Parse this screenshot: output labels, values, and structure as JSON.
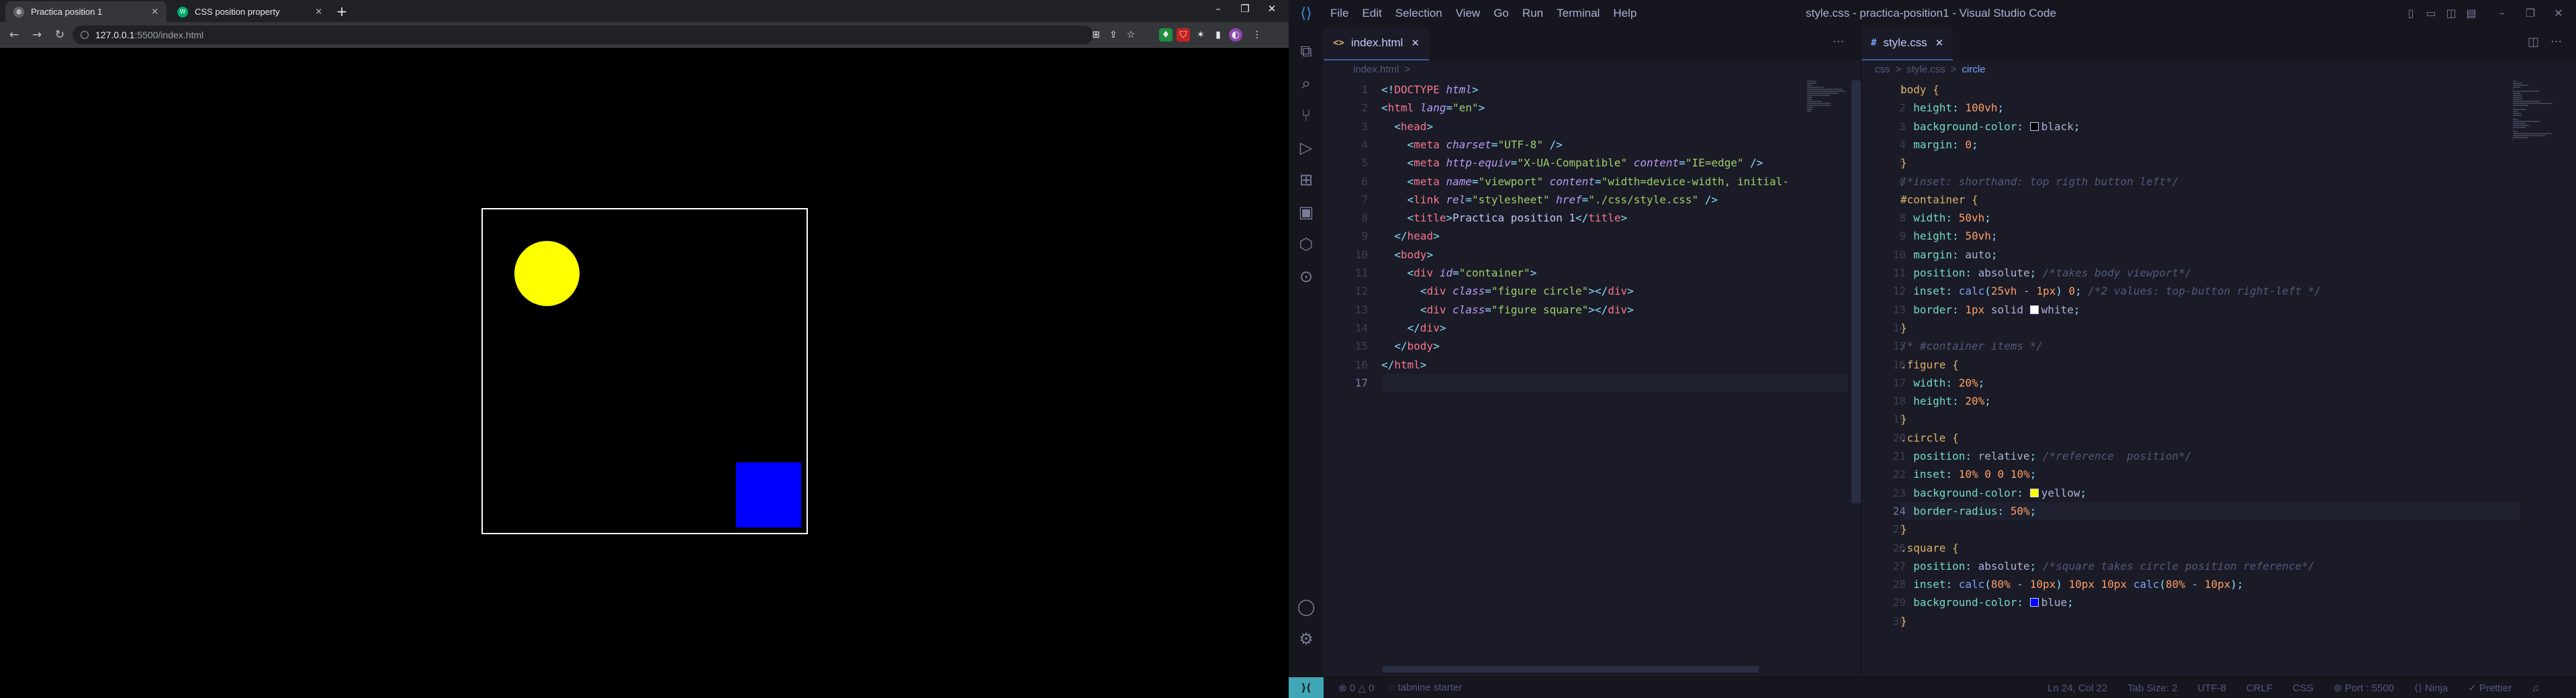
{
  "browser": {
    "tabs": [
      {
        "title": "Practica position 1",
        "favicon": "globe-icon",
        "active": true
      },
      {
        "title": "CSS position property",
        "favicon": "w3schools-icon",
        "active": false
      }
    ],
    "tab_close": "×",
    "new_tab": "+",
    "window_controls": {
      "minimize": "–",
      "maximize": "❐",
      "close": "✕"
    },
    "url": {
      "host": "127.0.0.1",
      "path": ":5500/index.html"
    },
    "nav": {
      "back": "←",
      "forward": "→",
      "reload": "↻"
    },
    "extensions": [
      "⊞",
      "⇪",
      "☆",
      "♦",
      "⛉",
      "✶",
      "▮",
      "◐",
      "⋮"
    ],
    "page": {
      "container_border": "#ffffff",
      "circle_color": "#ffff00",
      "square_color": "#0000ff",
      "background": "#000000"
    }
  },
  "vscode": {
    "menu": [
      "File",
      "Edit",
      "Selection",
      "View",
      "Go",
      "Run",
      "Terminal",
      "Help"
    ],
    "window_title": "style.css - practica-position1 - Visual Studio Code",
    "title_controls": [
      "▯",
      "▭",
      "◫",
      "▤",
      "–",
      "❐",
      "✕"
    ],
    "activity": [
      "⧉",
      "⌕",
      "⑂",
      "▷",
      "⊞",
      "▣",
      "⬡",
      "⊙"
    ],
    "activity_bottom": [
      "◯",
      "⚙"
    ],
    "left_editor": {
      "tab": {
        "icon": "<>",
        "name": "index.html",
        "close": "✕"
      },
      "more": "···",
      "breadcrumb": [
        "index.html",
        ">"
      ],
      "current_line": 17,
      "lines": [
        [
          [
            "pu",
            "<!"
          ],
          [
            "tg",
            "DOCTYPE"
          ],
          [
            "tx",
            " "
          ],
          [
            "at",
            "html"
          ],
          [
            "pu",
            ">"
          ]
        ],
        [
          [
            "pu",
            "<"
          ],
          [
            "tg",
            "html"
          ],
          [
            "tx",
            " "
          ],
          [
            "at",
            "lang"
          ],
          [
            "pu",
            "="
          ],
          [
            "st",
            "\"en\""
          ],
          [
            "pu",
            ">"
          ]
        ],
        [
          [
            "tx",
            "  "
          ],
          [
            "pu",
            "<"
          ],
          [
            "tg",
            "head"
          ],
          [
            "pu",
            ">"
          ]
        ],
        [
          [
            "tx",
            "    "
          ],
          [
            "pu",
            "<"
          ],
          [
            "tg",
            "meta"
          ],
          [
            "tx",
            " "
          ],
          [
            "at",
            "charset"
          ],
          [
            "pu",
            "="
          ],
          [
            "st",
            "\"UTF-8\""
          ],
          [
            "tx",
            " "
          ],
          [
            "pu",
            "/>"
          ]
        ],
        [
          [
            "tx",
            "    "
          ],
          [
            "pu",
            "<"
          ],
          [
            "tg",
            "meta"
          ],
          [
            "tx",
            " "
          ],
          [
            "at",
            "http-equiv"
          ],
          [
            "pu",
            "="
          ],
          [
            "st",
            "\"X-UA-Compatible\""
          ],
          [
            "tx",
            " "
          ],
          [
            "at",
            "content"
          ],
          [
            "pu",
            "="
          ],
          [
            "st",
            "\"IE=edge\""
          ],
          [
            "tx",
            " "
          ],
          [
            "pu",
            "/>"
          ]
        ],
        [
          [
            "tx",
            "    "
          ],
          [
            "pu",
            "<"
          ],
          [
            "tg",
            "meta"
          ],
          [
            "tx",
            " "
          ],
          [
            "at",
            "name"
          ],
          [
            "pu",
            "="
          ],
          [
            "st",
            "\"viewport\""
          ],
          [
            "tx",
            " "
          ],
          [
            "at",
            "content"
          ],
          [
            "pu",
            "="
          ],
          [
            "st",
            "\"width=device-width, initial-"
          ]
        ],
        [
          [
            "tx",
            "    "
          ],
          [
            "pu",
            "<"
          ],
          [
            "tg",
            "link"
          ],
          [
            "tx",
            " "
          ],
          [
            "at",
            "rel"
          ],
          [
            "pu",
            "="
          ],
          [
            "st",
            "\"stylesheet\""
          ],
          [
            "tx",
            " "
          ],
          [
            "at",
            "href"
          ],
          [
            "pu",
            "="
          ],
          [
            "st",
            "\"./css/style.css\""
          ],
          [
            "tx",
            " "
          ],
          [
            "pu",
            "/>"
          ]
        ],
        [
          [
            "tx",
            "    "
          ],
          [
            "pu",
            "<"
          ],
          [
            "tg",
            "title"
          ],
          [
            "pu",
            ">"
          ],
          [
            "dt",
            "Practica position 1"
          ],
          [
            "pu",
            "</"
          ],
          [
            "tg",
            "title"
          ],
          [
            "pu",
            ">"
          ]
        ],
        [
          [
            "tx",
            "  "
          ],
          [
            "pu",
            "</"
          ],
          [
            "tg",
            "head"
          ],
          [
            "pu",
            ">"
          ]
        ],
        [
          [
            "tx",
            "  "
          ],
          [
            "pu",
            "<"
          ],
          [
            "tg",
            "body"
          ],
          [
            "pu",
            ">"
          ]
        ],
        [
          [
            "tx",
            "    "
          ],
          [
            "pu",
            "<"
          ],
          [
            "tg",
            "div"
          ],
          [
            "tx",
            " "
          ],
          [
            "at",
            "id"
          ],
          [
            "pu",
            "="
          ],
          [
            "st",
            "\"container\""
          ],
          [
            "pu",
            ">"
          ]
        ],
        [
          [
            "tx",
            "      "
          ],
          [
            "pu",
            "<"
          ],
          [
            "tg",
            "div"
          ],
          [
            "tx",
            " "
          ],
          [
            "at",
            "class"
          ],
          [
            "pu",
            "="
          ],
          [
            "st",
            "\"figure circle\""
          ],
          [
            "pu",
            "></"
          ],
          [
            "tg",
            "div"
          ],
          [
            "pu",
            ">"
          ]
        ],
        [
          [
            "tx",
            "      "
          ],
          [
            "pu",
            "<"
          ],
          [
            "tg",
            "div"
          ],
          [
            "tx",
            " "
          ],
          [
            "at",
            "class"
          ],
          [
            "pu",
            "="
          ],
          [
            "st",
            "\"figure square\""
          ],
          [
            "pu",
            "></"
          ],
          [
            "tg",
            "div"
          ],
          [
            "pu",
            ">"
          ]
        ],
        [
          [
            "tx",
            "    "
          ],
          [
            "pu",
            "</"
          ],
          [
            "tg",
            "div"
          ],
          [
            "pu",
            ">"
          ]
        ],
        [
          [
            "tx",
            "  "
          ],
          [
            "pu",
            "</"
          ],
          [
            "tg",
            "body"
          ],
          [
            "pu",
            ">"
          ]
        ],
        [
          [
            "pu",
            "</"
          ],
          [
            "tg",
            "html"
          ],
          [
            "pu",
            ">"
          ]
        ],
        []
      ]
    },
    "right_editor": {
      "tab": {
        "icon": "#",
        "name": "style.css",
        "close": "✕"
      },
      "breadcrumb": [
        "css",
        ">",
        "style.css",
        ">",
        "circle"
      ],
      "split_icon": "◫",
      "more": "···",
      "current_line": 24,
      "lines": [
        [
          [
            "se",
            "body"
          ],
          [
            "tx",
            " "
          ],
          [
            "br",
            "{"
          ]
        ],
        [
          [
            "tx",
            "  "
          ],
          [
            "pr",
            "height"
          ],
          [
            "pu",
            ": "
          ],
          [
            "nu",
            "100vh"
          ],
          [
            "pu",
            ";"
          ]
        ],
        [
          [
            "tx",
            "  "
          ],
          [
            "pr",
            "background-color"
          ],
          [
            "pu",
            ": "
          ],
          [
            "sw",
            "#000000"
          ],
          [
            "tx",
            "black"
          ],
          [
            "pu",
            ";"
          ]
        ],
        [
          [
            "tx",
            "  "
          ],
          [
            "pr",
            "margin"
          ],
          [
            "pu",
            ": "
          ],
          [
            "nu",
            "0"
          ],
          [
            "pu",
            ";"
          ]
        ],
        [
          [
            "br",
            "}"
          ]
        ],
        [
          [
            "cm",
            "/*inset: shorthand: top rigth button left*/"
          ]
        ],
        [
          [
            "se",
            "#container"
          ],
          [
            "tx",
            " "
          ],
          [
            "br",
            "{"
          ]
        ],
        [
          [
            "tx",
            "  "
          ],
          [
            "pr",
            "width"
          ],
          [
            "pu",
            ": "
          ],
          [
            "nu",
            "50vh"
          ],
          [
            "pu",
            ";"
          ]
        ],
        [
          [
            "tx",
            "  "
          ],
          [
            "pr",
            "height"
          ],
          [
            "pu",
            ": "
          ],
          [
            "nu",
            "50vh"
          ],
          [
            "pu",
            ";"
          ]
        ],
        [
          [
            "tx",
            "  "
          ],
          [
            "pr",
            "margin"
          ],
          [
            "pu",
            ": "
          ],
          [
            "tx",
            "auto"
          ],
          [
            "pu",
            ";"
          ]
        ],
        [
          [
            "tx",
            "  "
          ],
          [
            "pr",
            "position"
          ],
          [
            "pu",
            ": "
          ],
          [
            "tx",
            "absolute"
          ],
          [
            "pu",
            "; "
          ],
          [
            "cm",
            "/*takes body viewport*/"
          ]
        ],
        [
          [
            "tx",
            "  "
          ],
          [
            "pr",
            "inset"
          ],
          [
            "pu",
            ": "
          ],
          [
            "fn",
            "calc"
          ],
          [
            "pu",
            "("
          ],
          [
            "nu",
            "25vh"
          ],
          [
            "tx",
            " - "
          ],
          [
            "nu",
            "1px"
          ],
          [
            "pu",
            ") "
          ],
          [
            "nu",
            "0"
          ],
          [
            "pu",
            "; "
          ],
          [
            "cm",
            "/*2 values: top-button right-left */"
          ]
        ],
        [
          [
            "tx",
            "  "
          ],
          [
            "pr",
            "border"
          ],
          [
            "pu",
            ": "
          ],
          [
            "nu",
            "1px"
          ],
          [
            "tx",
            " solid "
          ],
          [
            "sw",
            "#ffffff"
          ],
          [
            "tx",
            "white"
          ],
          [
            "pu",
            ";"
          ]
        ],
        [
          [
            "br",
            "}"
          ]
        ],
        [
          [
            "cm",
            "/* #container items */"
          ]
        ],
        [
          [
            "se",
            ".figure"
          ],
          [
            "tx",
            " "
          ],
          [
            "br",
            "{"
          ]
        ],
        [
          [
            "tx",
            "  "
          ],
          [
            "pr",
            "width"
          ],
          [
            "pu",
            ": "
          ],
          [
            "nu",
            "20%"
          ],
          [
            "pu",
            ";"
          ]
        ],
        [
          [
            "tx",
            "  "
          ],
          [
            "pr",
            "height"
          ],
          [
            "pu",
            ": "
          ],
          [
            "nu",
            "20%"
          ],
          [
            "pu",
            ";"
          ]
        ],
        [
          [
            "br",
            "}"
          ]
        ],
        [
          [
            "se",
            ".circle"
          ],
          [
            "tx",
            " "
          ],
          [
            "br",
            "{"
          ]
        ],
        [
          [
            "tx",
            "  "
          ],
          [
            "pr",
            "position"
          ],
          [
            "pu",
            ": "
          ],
          [
            "tx",
            "relative"
          ],
          [
            "pu",
            "; "
          ],
          [
            "cm",
            "/*reference  position*/"
          ]
        ],
        [
          [
            "tx",
            "  "
          ],
          [
            "pr",
            "inset"
          ],
          [
            "pu",
            ": "
          ],
          [
            "nu",
            "10%"
          ],
          [
            "tx",
            " "
          ],
          [
            "nu",
            "0"
          ],
          [
            "tx",
            " "
          ],
          [
            "nu",
            "0"
          ],
          [
            "tx",
            " "
          ],
          [
            "nu",
            "10%"
          ],
          [
            "pu",
            ";"
          ]
        ],
        [
          [
            "tx",
            "  "
          ],
          [
            "pr",
            "background-color"
          ],
          [
            "pu",
            ": "
          ],
          [
            "sw",
            "#ffff00"
          ],
          [
            "tx",
            "yellow"
          ],
          [
            "pu",
            ";"
          ]
        ],
        [
          [
            "tx",
            "  "
          ],
          [
            "pr",
            "border-radius"
          ],
          [
            "pu",
            ": "
          ],
          [
            "nu",
            "50%"
          ],
          [
            "pu",
            ";"
          ]
        ],
        [
          [
            "br",
            "}"
          ]
        ],
        [
          [
            "se",
            ".square"
          ],
          [
            "tx",
            " "
          ],
          [
            "br",
            "{"
          ]
        ],
        [
          [
            "tx",
            "  "
          ],
          [
            "pr",
            "position"
          ],
          [
            "pu",
            ": "
          ],
          [
            "tx",
            "absolute"
          ],
          [
            "pu",
            "; "
          ],
          [
            "cm",
            "/*square takes circle position reference*/"
          ]
        ],
        [
          [
            "tx",
            "  "
          ],
          [
            "pr",
            "inset"
          ],
          [
            "pu",
            ": "
          ],
          [
            "fn",
            "calc"
          ],
          [
            "pu",
            "("
          ],
          [
            "nu",
            "80%"
          ],
          [
            "tx",
            " - "
          ],
          [
            "nu",
            "10px"
          ],
          [
            "pu",
            ") "
          ],
          [
            "nu",
            "10px"
          ],
          [
            "tx",
            " "
          ],
          [
            "nu",
            "10px"
          ],
          [
            "tx",
            " "
          ],
          [
            "fn",
            "calc"
          ],
          [
            "pu",
            "("
          ],
          [
            "nu",
            "80%"
          ],
          [
            "tx",
            " - "
          ],
          [
            "nu",
            "10px"
          ],
          [
            "pu",
            ");"
          ]
        ],
        [
          [
            "tx",
            "  "
          ],
          [
            "pr",
            "background-color"
          ],
          [
            "pu",
            ": "
          ],
          [
            "sw",
            "#0000ff"
          ],
          [
            "tx",
            "blue"
          ],
          [
            "pu",
            ";"
          ]
        ],
        [
          [
            "br",
            "}"
          ]
        ]
      ]
    },
    "status": {
      "remote": "⟩⟨",
      "problems": "⊗ 0 △ 0",
      "tabnine": "◌ tabnine starter",
      "right": [
        "Ln 24, Col 22",
        "Tab Size: 2",
        "UTF-8",
        "CRLF",
        "CSS",
        "⊚ Port : 5500",
        "⟨⟩ Ninja",
        "✓ Prettier",
        "♫"
      ]
    }
  }
}
